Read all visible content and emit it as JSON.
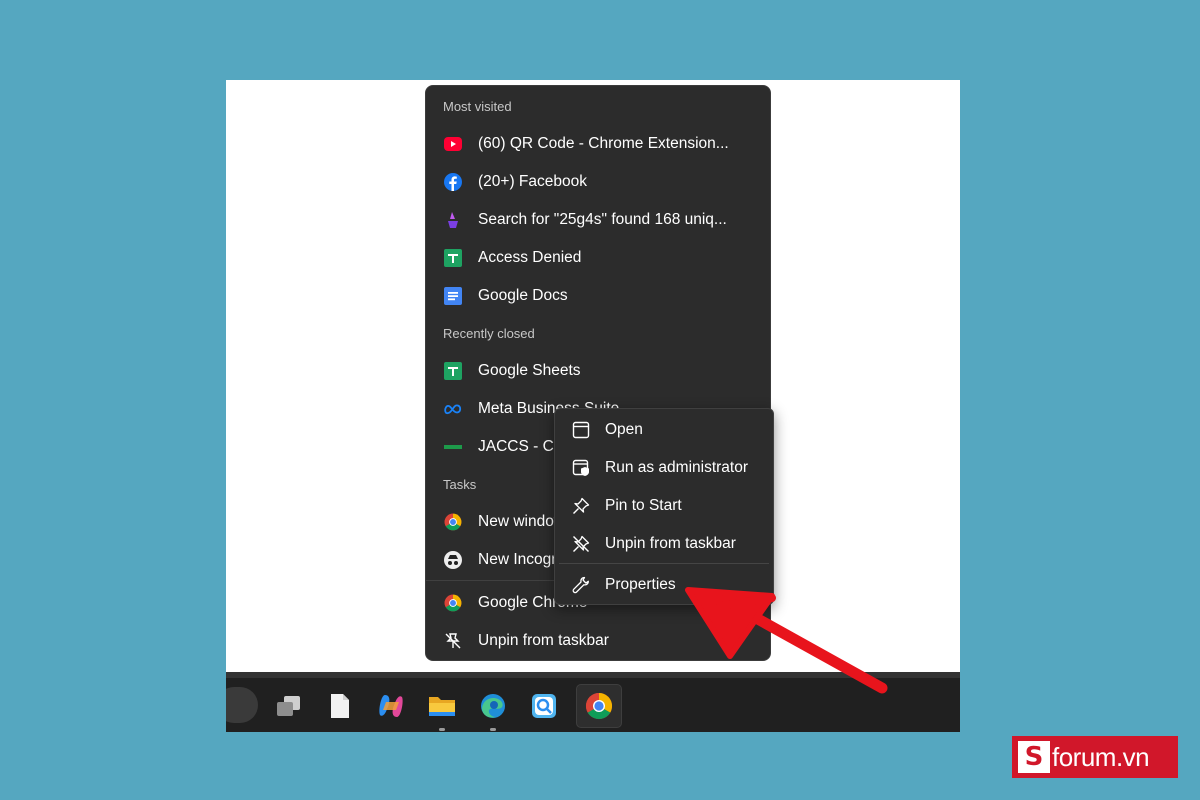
{
  "jump_list": {
    "most_visited_title": "Most visited",
    "most_visited": [
      {
        "label": "(60) QR Code - Chrome Extension...",
        "icon": "youtube-icon"
      },
      {
        "label": "(20+) Facebook",
        "icon": "facebook-icon"
      },
      {
        "label": "Search for \"25g4s\" found 168 uniq...",
        "icon": "search-site-icon"
      },
      {
        "label": "Access Denied",
        "icon": "google-sheets-icon"
      },
      {
        "label": "Google Docs",
        "icon": "google-docs-icon"
      }
    ],
    "recently_closed_title": "Recently closed",
    "recently_closed": [
      {
        "label": "Google Sheets",
        "icon": "google-sheets-icon"
      },
      {
        "label": "Meta Business Suite",
        "icon": "meta-icon"
      },
      {
        "label": "JACCS - Cô",
        "icon": "jaccs-icon"
      }
    ],
    "tasks_title": "Tasks",
    "tasks": [
      {
        "label": "New window",
        "icon": "chrome-icon"
      },
      {
        "label": "New Incognito window",
        "icon": "incognito-icon"
      }
    ],
    "app_items": [
      {
        "label": "Google Chrome",
        "icon": "chrome-icon"
      },
      {
        "label": "Unpin from taskbar",
        "icon": "unpin-icon"
      }
    ]
  },
  "context_menu": {
    "items": [
      {
        "label": "Open",
        "icon": "window-icon"
      },
      {
        "label": "Run as administrator",
        "icon": "shield-window-icon"
      },
      {
        "label": "Pin to Start",
        "icon": "pin-icon"
      },
      {
        "label": "Unpin from taskbar",
        "icon": "unpin-icon"
      },
      {
        "label": "Properties",
        "icon": "wrench-icon"
      }
    ]
  },
  "taskbar": {
    "icons": [
      "task-view-icon",
      "file-icon",
      "copilot-icon",
      "file-explorer-icon",
      "edge-icon",
      "quick-assist-icon",
      "chrome-icon"
    ],
    "active": "chrome-icon"
  },
  "watermark": {
    "mark": "S",
    "text": "forum.vn"
  },
  "colors": {
    "background": "#55a7c0",
    "menu_bg": "#2c2c2c",
    "arrow": "#e8141c",
    "brand": "#d1172a"
  }
}
